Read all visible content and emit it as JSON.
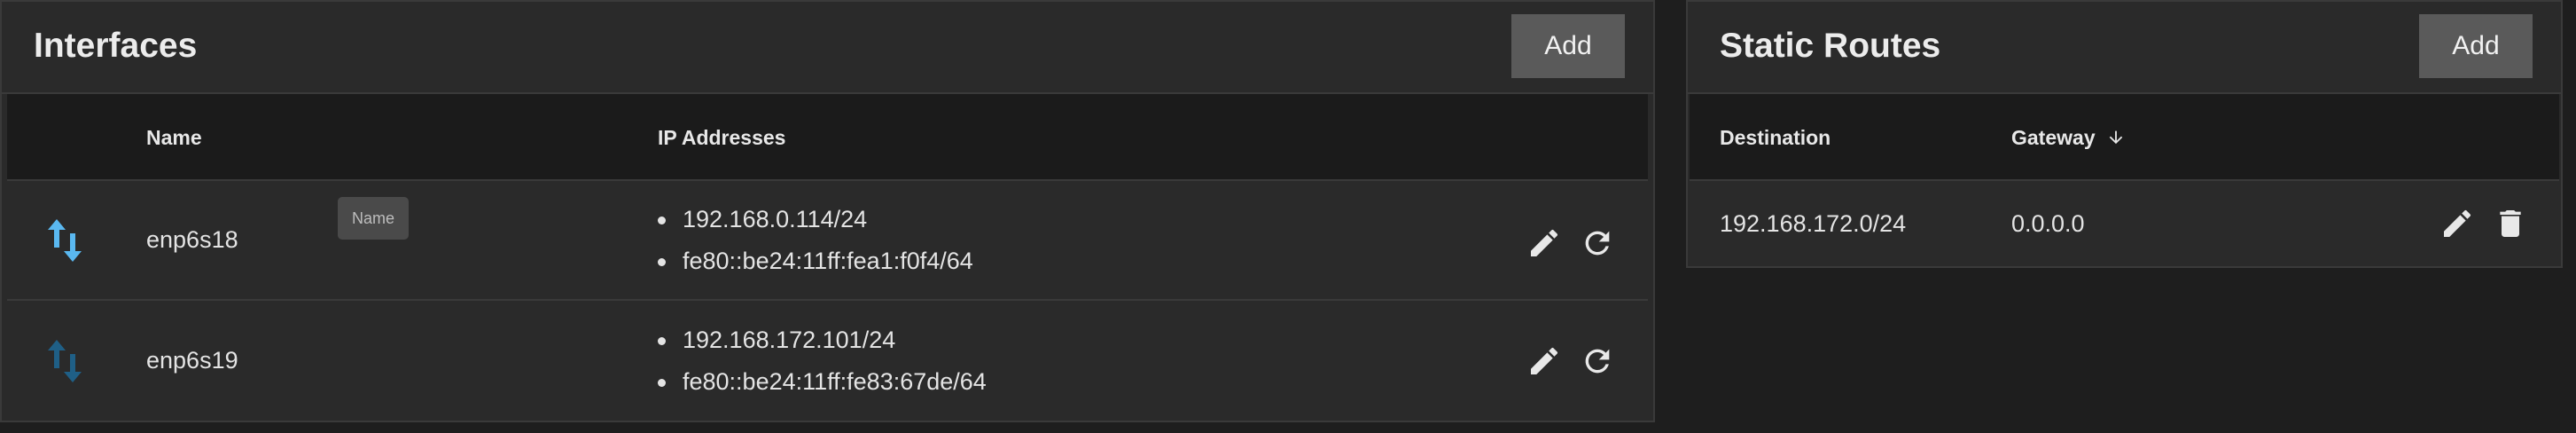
{
  "interfaces": {
    "title": "Interfaces",
    "add_label": "Add",
    "columns": {
      "name": "Name",
      "ip_addresses": "IP Addresses"
    },
    "tooltip": "Name",
    "rows": [
      {
        "name": "enp6s18",
        "status": "active",
        "ips": [
          "192.168.0.114/24",
          "fe80::be24:11ff:fea1:f0f4/64"
        ]
      },
      {
        "name": "enp6s19",
        "status": "inactive",
        "ips": [
          "192.168.172.101/24",
          "fe80::be24:11ff:fe83:67de/64"
        ]
      }
    ]
  },
  "static_routes": {
    "title": "Static Routes",
    "add_label": "Add",
    "columns": {
      "destination": "Destination",
      "gateway": "Gateway"
    },
    "rows": [
      {
        "destination": "192.168.172.0/24",
        "gateway": "0.0.0.0"
      }
    ]
  },
  "colors": {
    "active_link": "#5ab8f0",
    "inactive_link": "#1f5f86",
    "background": "#1e1e1e",
    "card": "#2a2a2a",
    "button": "#5a5a5a"
  },
  "icons": {
    "status": "arrows-up-down-icon",
    "edit": "pencil-icon",
    "reset": "refresh-icon",
    "delete": "trash-icon",
    "sort": "arrow-down-icon"
  }
}
